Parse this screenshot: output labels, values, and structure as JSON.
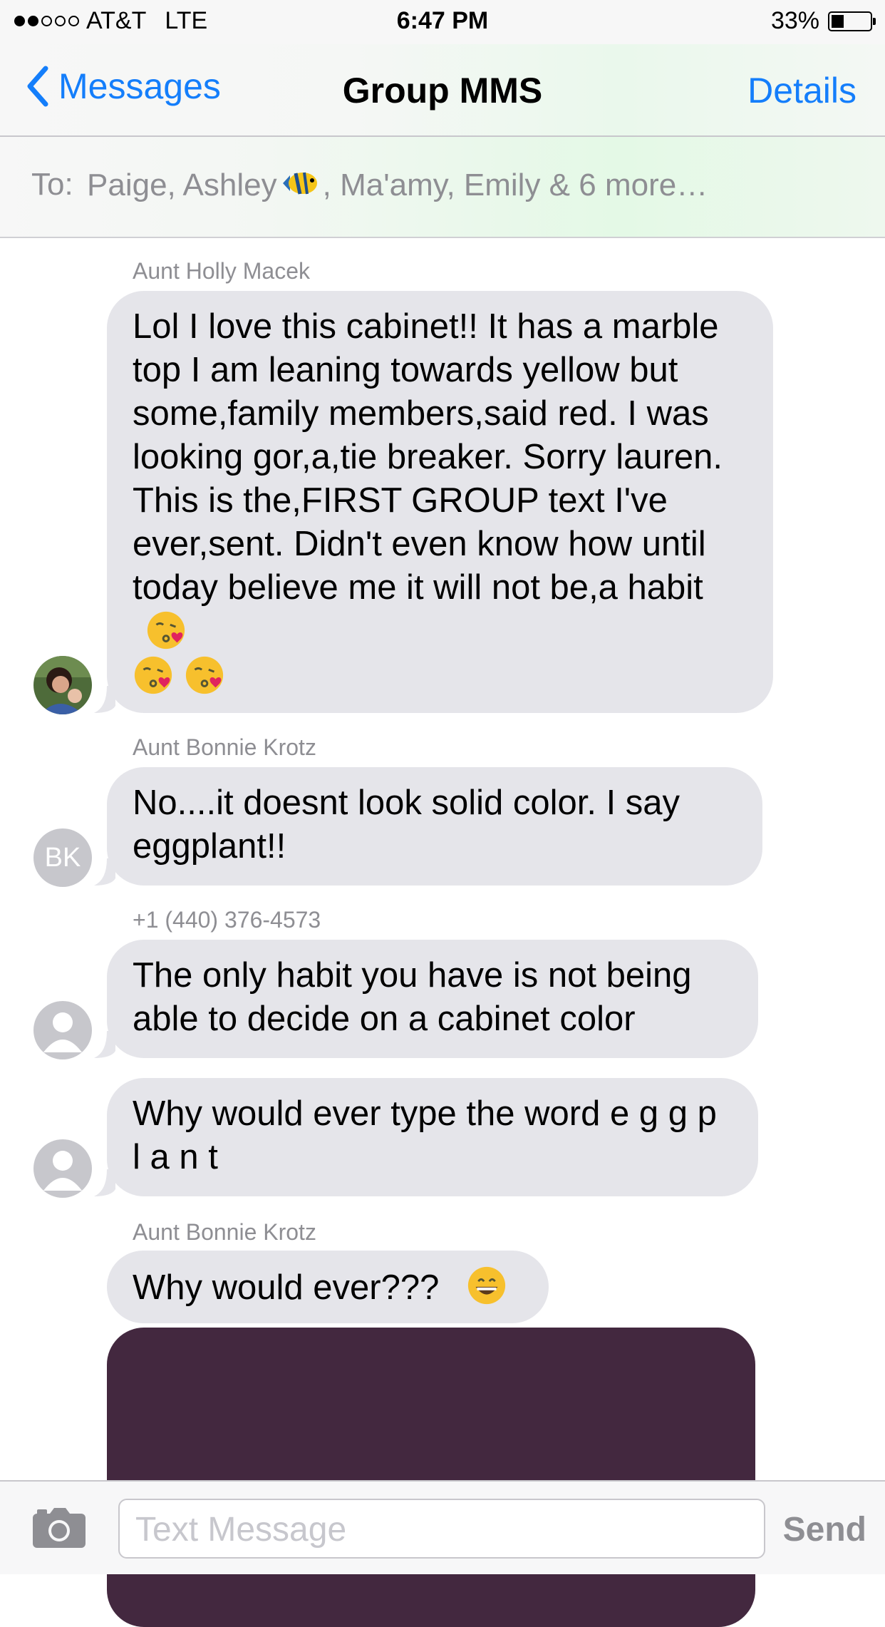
{
  "status_bar": {
    "carrier": "AT&T",
    "network": "LTE",
    "time": "6:47 PM",
    "battery": "33%",
    "battery_level": 0.33,
    "signal_bars_filled": 2,
    "signal_bars_total": 5
  },
  "nav": {
    "back_label": "Messages",
    "title": "Group MMS",
    "details_label": "Details"
  },
  "recipients": {
    "label": "To:",
    "names_before_emoji": "Paige, Ashley",
    "names_after_emoji": ", Ma'amy, Emily & 6 more…",
    "emoji": "tropical-fish-icon"
  },
  "messages": [
    {
      "sender": "Aunt Holly Macek",
      "text": "Lol I love this cabinet!! It has a marble top I am leaning towards yellow but some,family members,said red. I was looking gor,a,tie breaker. Sorry lauren. This is the,FIRST GROUP text I've ever,sent. Didn't even know how  until today believe me it will not be,a habit",
      "emoji": [
        "kissing-heart-emoji",
        "kissing-heart-emoji",
        "kissing-heart-emoji"
      ],
      "avatar": "photo"
    },
    {
      "sender": "Aunt Bonnie Krotz",
      "text": "No....it doesnt look solid color.  I say eggplant!!",
      "avatar_initials": "BK"
    },
    {
      "sender": "+1 (440) 376-4573",
      "text": "The only habit you have is not being able to decide on a cabinet color",
      "avatar": "generic-person"
    },
    {
      "sender": "",
      "text": "Why would ever type the word e g g p l a n t",
      "avatar": "generic-person"
    },
    {
      "sender": "Aunt Bonnie Krotz",
      "text": "Why would ever???",
      "emoji": [
        "grinning-emoji"
      ]
    },
    {
      "type": "image",
      "color": "#43283f"
    }
  ],
  "input": {
    "placeholder": "Text Message",
    "send_label": "Send"
  },
  "colors": {
    "accent": "#147efb",
    "bubble": "#e5e5ea",
    "muted": "#8e8e93"
  }
}
